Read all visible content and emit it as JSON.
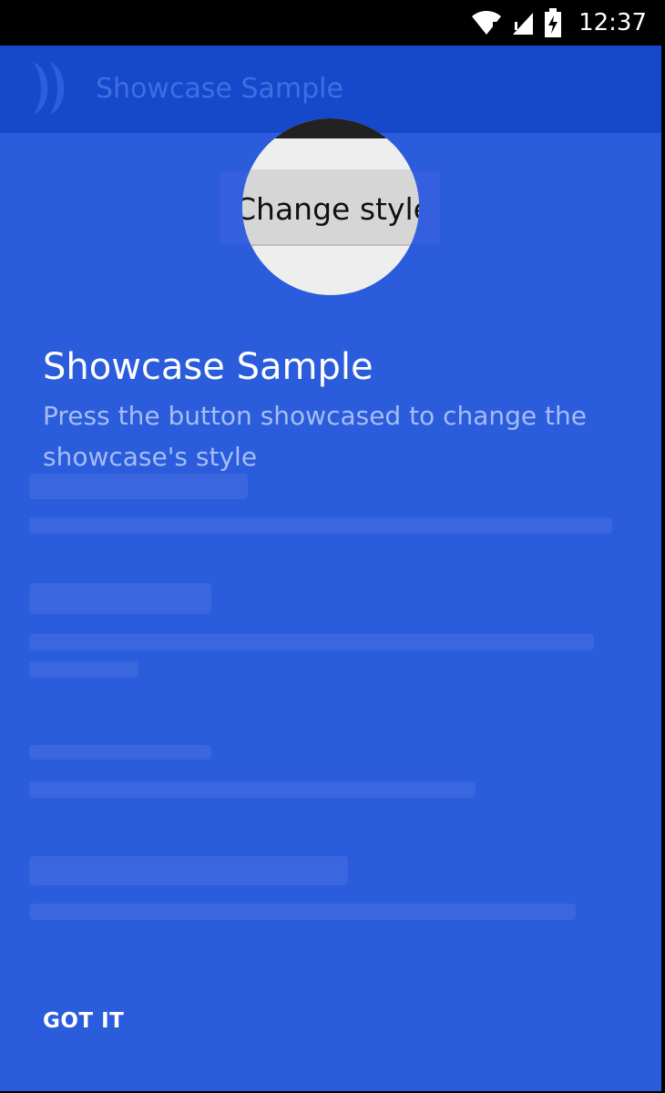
{
  "status_bar": {
    "time": "12:37",
    "icons": [
      "wifi-icon",
      "signal-icon",
      "battery-icon"
    ]
  },
  "app_bar": {
    "title": "Showcase Sample",
    "logo": "app-logo-icon"
  },
  "highlighted": {
    "button_label": "Change style"
  },
  "showcase": {
    "title": "Showcase Sample",
    "text": "Press the button showcased to change the showcase's style",
    "dismiss_label": "GOT IT"
  },
  "colors": {
    "overlay": "#2a5cdc",
    "app_bar": "#1648cc",
    "title_text": "#ffffff",
    "body_text": "#a7bcf4"
  }
}
